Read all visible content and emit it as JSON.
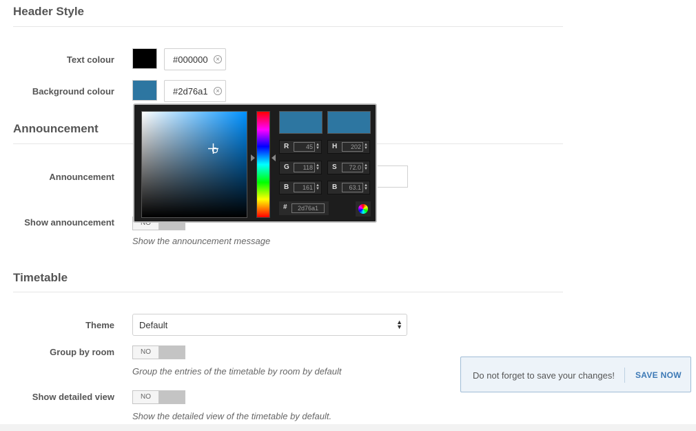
{
  "header_style": {
    "title": "Header Style",
    "text_colour": {
      "label": "Text colour",
      "value": "#000000",
      "swatch": "#000000"
    },
    "background_colour": {
      "label": "Background colour",
      "value": "#2d76a1",
      "swatch": "#2d76a1"
    }
  },
  "announcement": {
    "title": "Announcement",
    "field_label": "Announcement",
    "show_label": "Show announcement",
    "show_toggle": "NO",
    "show_hint": "Show the announcement message"
  },
  "timetable": {
    "title": "Timetable",
    "theme_label": "Theme",
    "theme_value": "Default",
    "group_label": "Group by room",
    "group_toggle": "NO",
    "group_hint": "Group the entries of the timetable by room by default",
    "detailed_label": "Show detailed view",
    "detailed_toggle": "NO",
    "detailed_hint": "Show the detailed view of the timetable by default."
  },
  "color_picker": {
    "new_color": "#2d76a1",
    "current_color": "#2d76a1",
    "hue_base": "#0091ff",
    "r": {
      "key": "R",
      "value": "45"
    },
    "g": {
      "key": "G",
      "value": "118"
    },
    "b": {
      "key": "B",
      "value": "161"
    },
    "h": {
      "key": "H",
      "value": "202"
    },
    "s": {
      "key": "S",
      "value": "72.0"
    },
    "bri": {
      "key": "B",
      "value": "63.1"
    },
    "hex": {
      "key": "#",
      "value": "2d76a1"
    }
  },
  "save_notice": {
    "message": "Do not forget to save your changes!",
    "button": "SAVE NOW"
  }
}
